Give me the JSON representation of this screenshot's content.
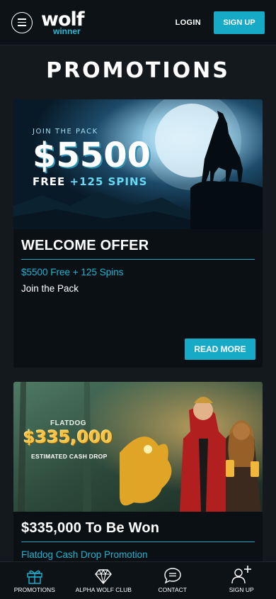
{
  "header": {
    "logo_main": "wolf",
    "logo_sub": "winner",
    "login": "LOGIN",
    "signup": "SIGN UP"
  },
  "page_title": "PROMOTIONS",
  "promotions": [
    {
      "banner_tagline": "JOIN THE PACK",
      "banner_amount": "$5500",
      "banner_free": "FREE",
      "banner_spins": "+125 SPINS",
      "title": "WELCOME OFFER",
      "subtitle": "$5500 Free + 125 Spins",
      "description": "Join the Pack",
      "cta": "READ MORE"
    },
    {
      "banner_brand": "FLATDOG",
      "banner_amount": "$335,000",
      "banner_caption": "ESTIMATED CASH DROP",
      "title": "$335,000 To Be Won",
      "subtitle": "Flatdog Cash Drop Promotion"
    }
  ],
  "bottom_nav": [
    {
      "label": "PROMOTIONS",
      "icon": "gift-icon"
    },
    {
      "label": "ALPHA WOLF CLUB",
      "icon": "diamond-icon"
    },
    {
      "label": "CONTACT",
      "icon": "chat-icon"
    },
    {
      "label": "SIGN UP",
      "icon": "add-user-icon"
    }
  ],
  "colors": {
    "accent": "#16aac7",
    "background": "#14191e",
    "card": "#0b1014"
  }
}
